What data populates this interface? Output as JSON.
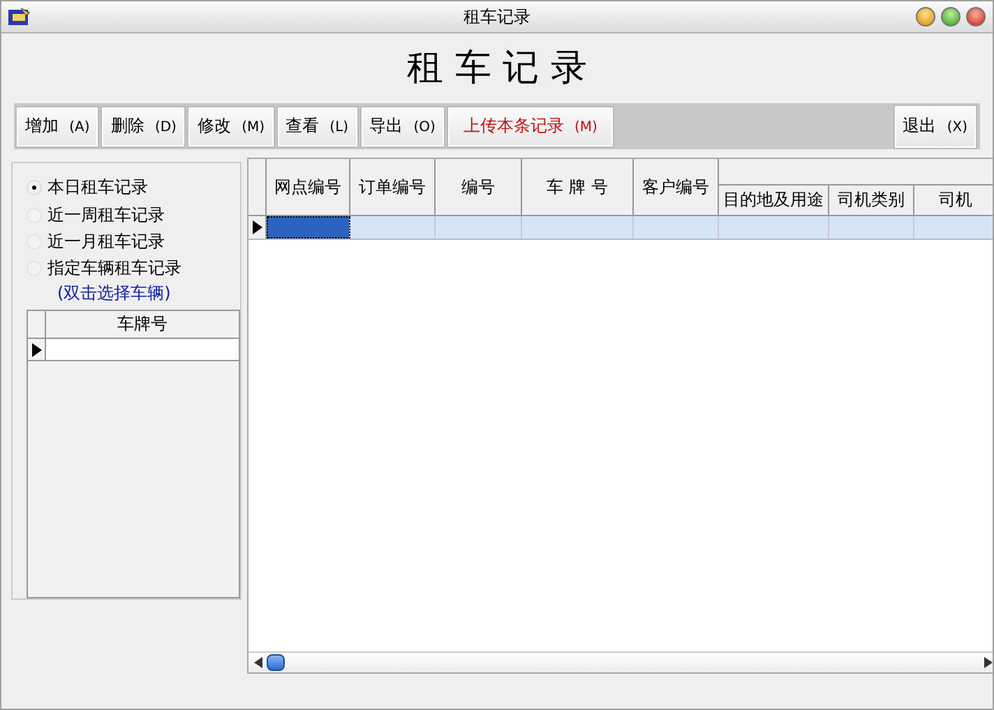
{
  "window": {
    "title": "租车记录"
  },
  "heading": "租 车 记 录",
  "toolbar": [
    {
      "label": "增加",
      "key": "(A)",
      "kind": "normal"
    },
    {
      "label": "删除",
      "key": "(D)",
      "kind": "normal"
    },
    {
      "label": "修改",
      "key": "(M)",
      "kind": "normal"
    },
    {
      "label": "查看",
      "key": "(L)",
      "kind": "normal"
    },
    {
      "label": "导出",
      "key": "(O)",
      "kind": "normal"
    },
    {
      "label": "上传本条记录",
      "key": "(M)",
      "kind": "accent"
    }
  ],
  "exit_button": {
    "label": "退出",
    "key": "(X)"
  },
  "filters": [
    {
      "label": "本日租车记录",
      "selected": true
    },
    {
      "label": "近一周租车记录",
      "selected": false
    },
    {
      "label": "近一月租车记录",
      "selected": false
    },
    {
      "label": "指定车辆租车记录",
      "selected": false
    }
  ],
  "filter_hint": "(双击选择车辆)",
  "vehicle_table": {
    "columns": [
      "车牌号"
    ],
    "rows": [
      {
        "current": true
      }
    ]
  },
  "records_table": {
    "columns": [
      "网点编号",
      "订单编号",
      "编号",
      "车 牌 号",
      "客户编号"
    ],
    "group": {
      "columns": [
        "目的地及用途",
        "司机类别",
        "司机"
      ]
    },
    "rows": [
      {
        "current": true,
        "cells": [
          {
            "selected": true
          },
          {
            "selected": false
          },
          {
            "selected": false
          },
          {
            "selected": false
          },
          {
            "selected": false
          },
          {
            "selected": false
          },
          {
            "selected": false
          },
          {
            "selected": false
          }
        ]
      }
    ]
  }
}
